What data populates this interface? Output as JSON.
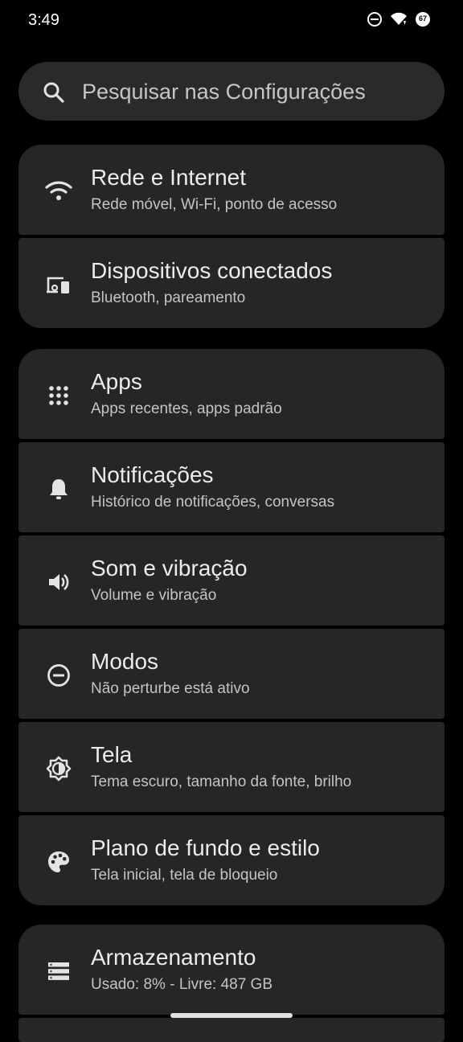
{
  "status_bar": {
    "time": "3:49",
    "icons": [
      "do-not-disturb-icon",
      "wifi-icon",
      "battery-icon"
    ],
    "battery_level": "67"
  },
  "search": {
    "placeholder": "Pesquisar nas Configurações"
  },
  "groups": [
    {
      "items": [
        {
          "icon": "wifi-icon",
          "title": "Rede e Internet",
          "subtitle": "Rede móvel, Wi-Fi, ponto de acesso"
        },
        {
          "icon": "connected-devices-icon",
          "title": "Dispositivos conectados",
          "subtitle": "Bluetooth, pareamento"
        }
      ]
    },
    {
      "items": [
        {
          "icon": "apps-grid-icon",
          "title": "Apps",
          "subtitle": "Apps recentes, apps padrão"
        },
        {
          "icon": "bell-icon",
          "title": "Notificações",
          "subtitle": "Histórico de notificações, conversas"
        },
        {
          "icon": "speaker-icon",
          "title": "Som e vibração",
          "subtitle": "Volume e vibração"
        },
        {
          "icon": "do-not-disturb-icon",
          "title": "Modos",
          "subtitle": "Não perturbe está ativo"
        },
        {
          "icon": "brightness-icon",
          "title": "Tela",
          "subtitle": "Tema escuro, tamanho da fonte, brilho"
        },
        {
          "icon": "palette-icon",
          "title": "Plano de fundo e estilo",
          "subtitle": "Tela inicial, tela de bloqueio"
        }
      ]
    },
    {
      "items": [
        {
          "icon": "storage-icon",
          "title": "Armazenamento",
          "subtitle": "Usado: 8% - Livre: 487 GB"
        }
      ]
    }
  ],
  "colors": {
    "background": "#000000",
    "card": "#262626",
    "search_bg": "#282a2c",
    "title_text": "#ececec",
    "subtitle_text": "#c4c4c4"
  }
}
